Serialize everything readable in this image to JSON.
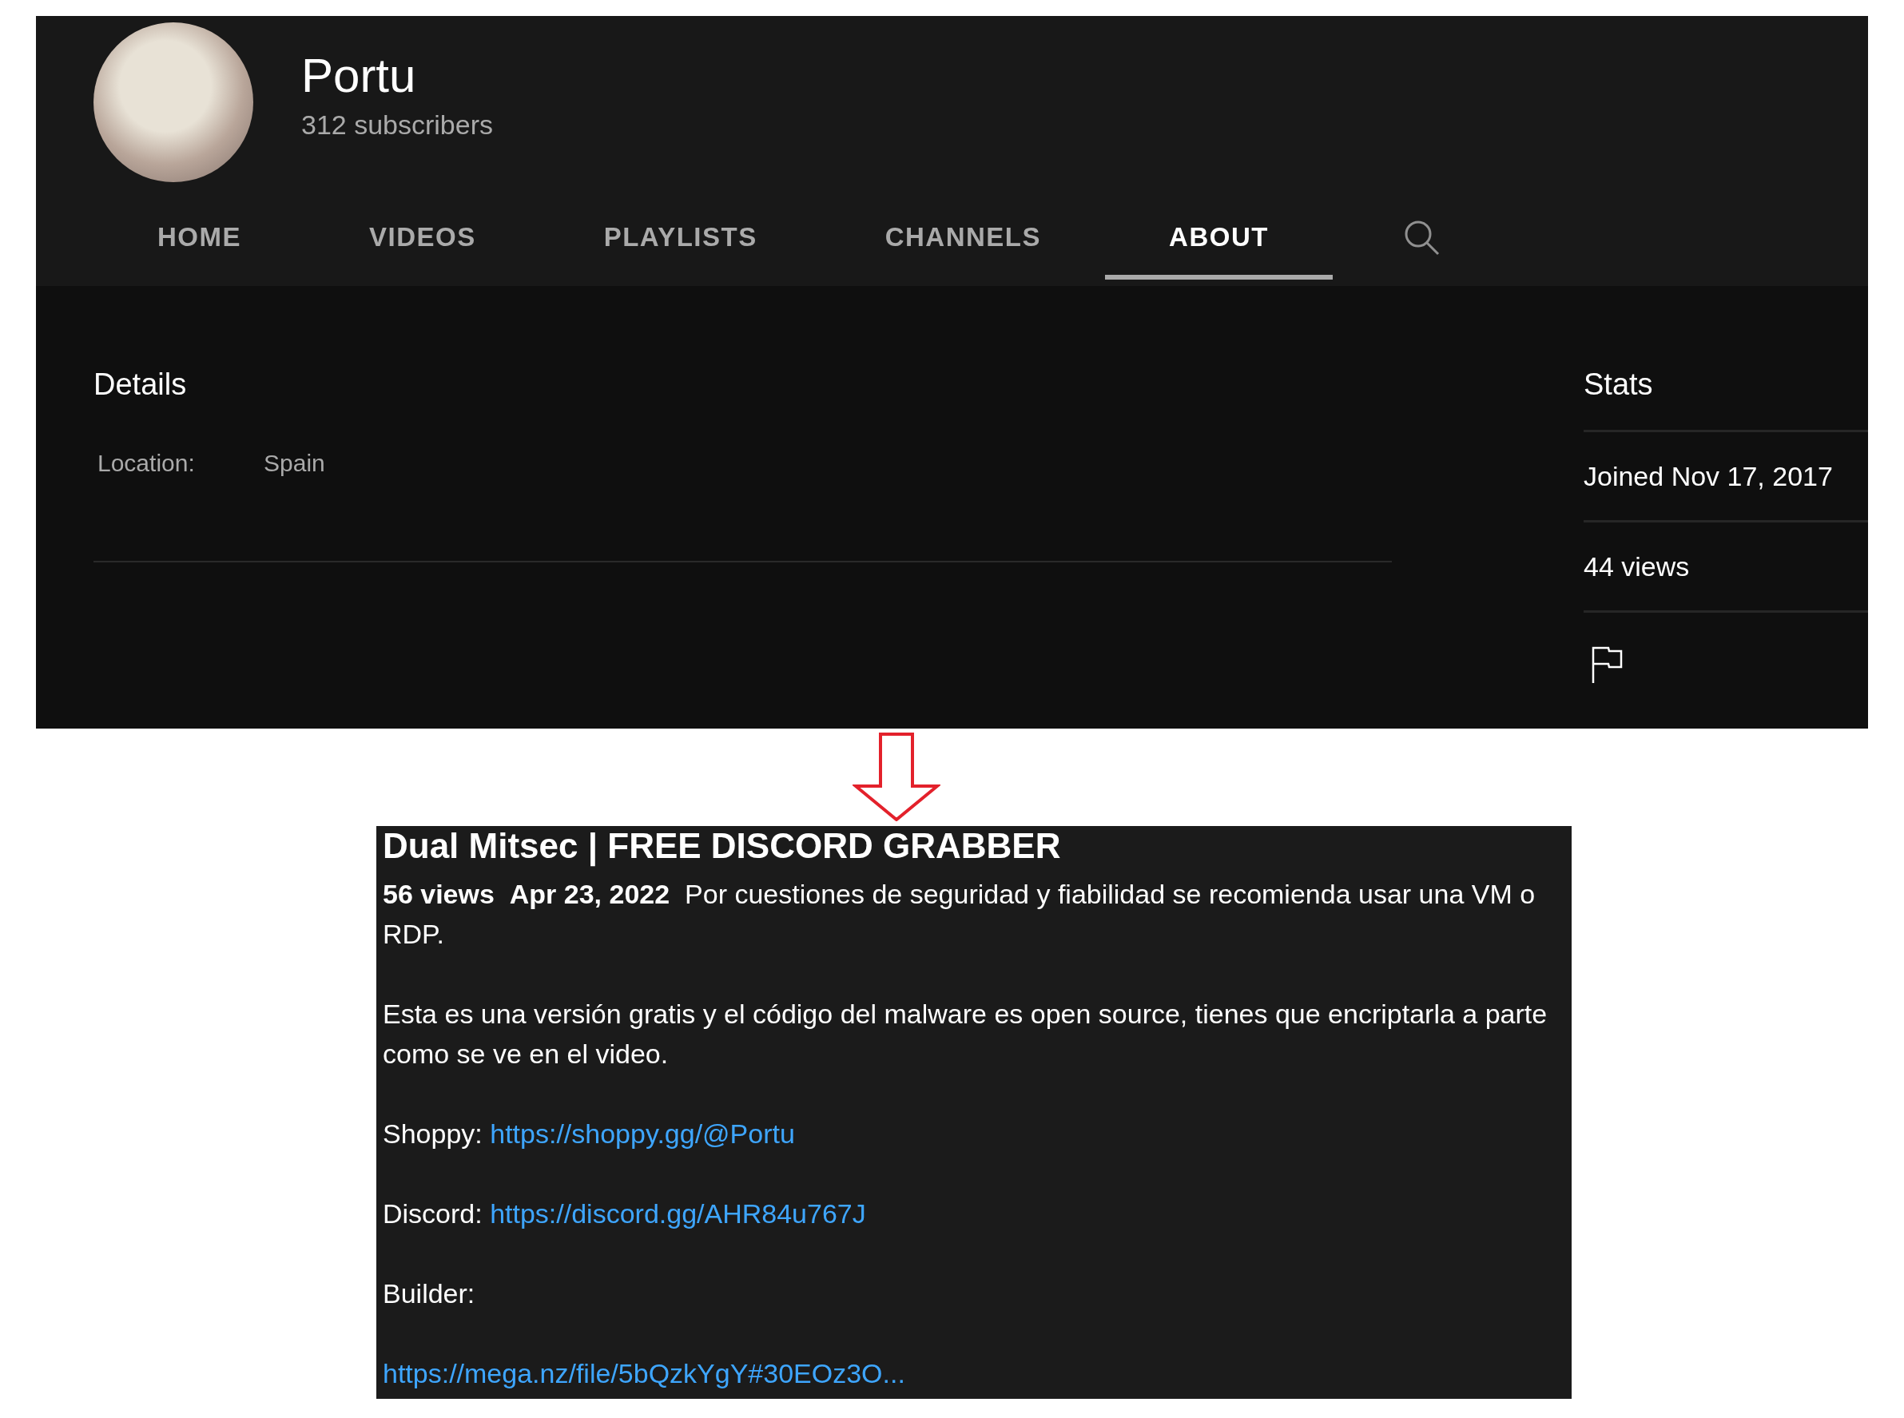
{
  "channel": {
    "name": "Portu",
    "subscribers": "312 subscribers"
  },
  "tabs": [
    {
      "label": "HOME",
      "selected": false
    },
    {
      "label": "VIDEOS",
      "selected": false
    },
    {
      "label": "PLAYLISTS",
      "selected": false
    },
    {
      "label": "CHANNELS",
      "selected": false
    },
    {
      "label": "ABOUT",
      "selected": true
    }
  ],
  "details": {
    "title": "Details",
    "rows": [
      {
        "label": "Location:",
        "value": "Spain"
      }
    ]
  },
  "stats": {
    "title": "Stats",
    "items": [
      "Joined Nov 17, 2017",
      "44 views"
    ]
  },
  "video": {
    "title": "Dual Mitsec | FREE DISCORD GRABBER",
    "views": "56 views",
    "date": "Apr 23, 2022",
    "intro": "Por cuestiones de seguridad y fiabilidad se recomienda usar una VM o RDP.",
    "paragraphs": [
      {
        "kind": "text",
        "text": "Esta es una versión gratis y el código del malware es open source, tienes que encriptarla a parte como se ve en el video."
      },
      {
        "kind": "link",
        "label": "Shoppy:",
        "url": "https://shoppy.gg/@Portu"
      },
      {
        "kind": "link",
        "label": "Discord:",
        "url": "https://discord.gg/AHR84u767J"
      },
      {
        "kind": "text",
        "text": "Builder:"
      },
      {
        "kind": "url",
        "url": "https://mega.nz/file/5bQzkYgY#30EOz3O..."
      }
    ]
  }
}
